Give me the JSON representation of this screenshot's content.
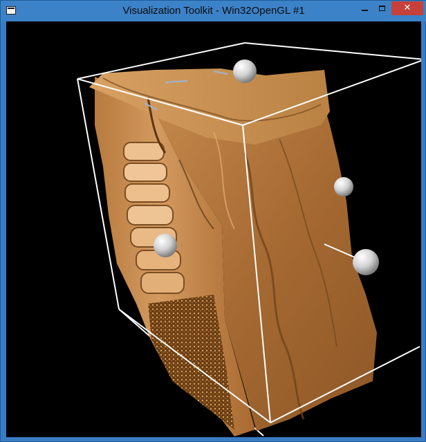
{
  "window": {
    "title": "Visualization Toolkit - Win32OpenGL #1",
    "icon": "window-app-icon",
    "controls": {
      "minimize": "minimize-icon",
      "maximize": "maximize-icon",
      "close": "close-icon",
      "close_glyph": "✕"
    }
  },
  "colors": {
    "frame": "#3a7cc4",
    "viewport_bg": "#000000",
    "bone_light": "#e8b783",
    "bone_mid": "#c78a4f",
    "bone_dark": "#7a4d22",
    "bounding_box": "#ffffff",
    "handle_sphere": "#dcdcdc"
  },
  "scene": {
    "content": "volume-rendered CT torso",
    "widgets": [
      "bounding-box-outline",
      "handle-sphere-top",
      "handle-sphere-left",
      "handle-sphere-right-upper",
      "handle-sphere-right"
    ]
  }
}
